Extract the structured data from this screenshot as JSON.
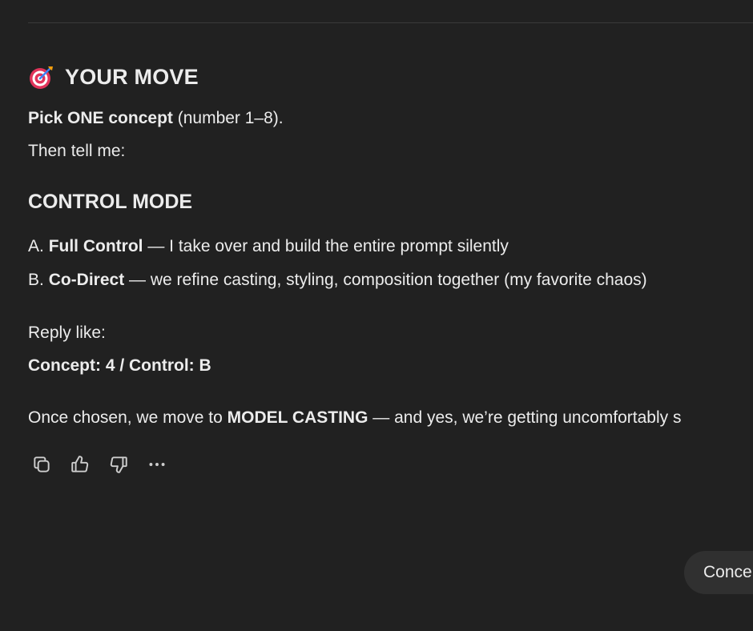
{
  "message": {
    "heading": "YOUR MOVE",
    "heading_icon": "target-icon",
    "pick_bold": "Pick ONE concept",
    "pick_rest": " (number 1–8).",
    "then_line": "Then tell me:",
    "control_heading": "CONTROL MODE",
    "option_a": {
      "prefix": "A. ",
      "name": "Full Control",
      "desc": " — I take over and build the entire prompt silently"
    },
    "option_b": {
      "prefix": "B. ",
      "name": "Co-Direct",
      "desc": " — we refine casting, styling, composition together (my favorite chaos)"
    },
    "reply_like": "Reply like:",
    "reply_example": "Concept: 4 / Control: B",
    "closing": {
      "before": "Once chosen, we move to ",
      "bold": "MODEL CASTING",
      "after": " — and yes, we’re getting uncomfortably s"
    }
  },
  "actions": {
    "copy_icon": "copy-icon",
    "like_icon": "thumbs-up-icon",
    "dislike_icon": "thumbs-down-icon",
    "more_icon": "more-icon"
  },
  "suggestion_pill": {
    "label": "Conce"
  }
}
